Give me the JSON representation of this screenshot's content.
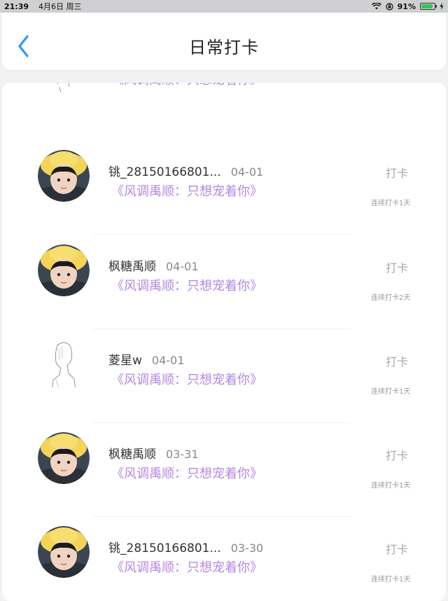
{
  "status_bar": {
    "time": "21:39",
    "date": "4月6日 周三",
    "battery": "91%",
    "battery_level": 0.91
  },
  "header": {
    "title": "日常打卡"
  },
  "partial_row": {
    "subtitle": "《风调禹顺：只想宠着你》"
  },
  "rows": [
    {
      "name": "铫_28150166801...",
      "date": "04-01",
      "subtitle": "《风调禹顺：只想宠着你》",
      "action": "打卡",
      "streak": "连续打卡1天",
      "avatar": "photo"
    },
    {
      "name": "枫糖禹顺",
      "date": "04-01",
      "subtitle": "《风调禹顺：只想宠着你》",
      "action": "打卡",
      "streak": "连续打卡2天",
      "avatar": "photo"
    },
    {
      "name": "菱星w",
      "date": "04-01",
      "subtitle": "《风调禹顺：只想宠着你》",
      "action": "打卡",
      "streak": "连续打卡1天",
      "avatar": "sketch"
    },
    {
      "name": "枫糖禹顺",
      "date": "03-31",
      "subtitle": "《风调禹顺：只想宠着你》",
      "action": "打卡",
      "streak": "连续打卡1天",
      "avatar": "photo"
    },
    {
      "name": "铫_28150166801...",
      "date": "03-30",
      "subtitle": "《风调禹顺：只想宠着你》",
      "action": "打卡",
      "streak": "连续打卡1天",
      "avatar": "photo"
    }
  ],
  "colors": {
    "accent_blue": "#2e9bea",
    "subtitle_purple": "#b388e0",
    "hat_yellow": "#f3d35a"
  }
}
